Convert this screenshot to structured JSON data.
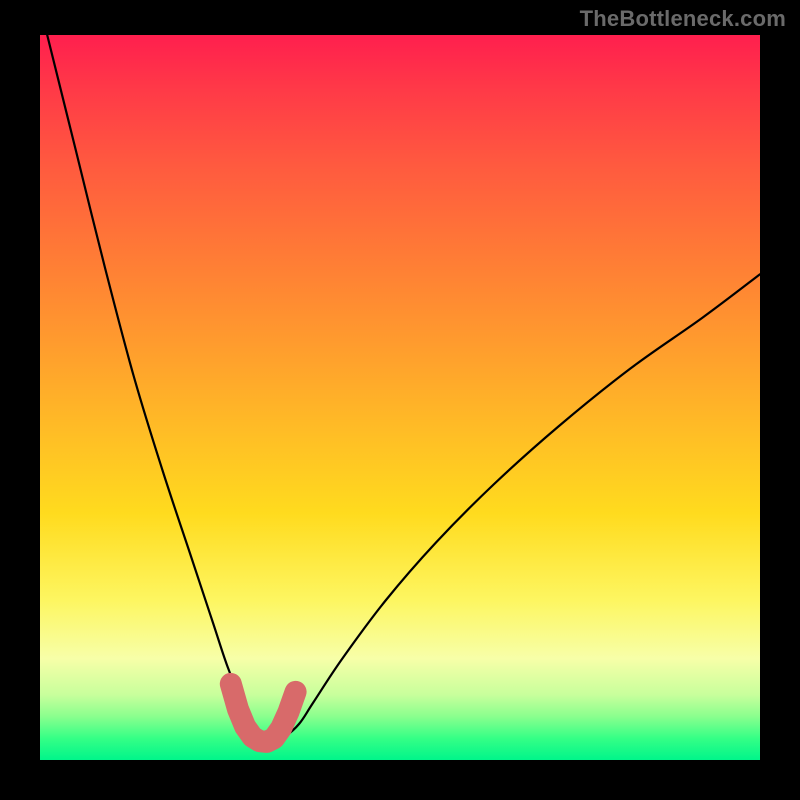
{
  "watermark": "TheBottleneck.com",
  "colors": {
    "frame": "#000000",
    "curve": "#000000",
    "marker": "#d86a6a"
  },
  "chart_data": {
    "type": "line",
    "title": "",
    "xlabel": "",
    "ylabel": "",
    "xlim": [
      0,
      100
    ],
    "ylim": [
      0,
      100
    ],
    "grid": false,
    "series": [
      {
        "name": "bottleneck-curve",
        "x": [
          1,
          5,
          9,
          13,
          17,
          21,
          24,
          26,
          28,
          29.5,
          31,
          32.5,
          34,
          36,
          38,
          42,
          48,
          55,
          63,
          72,
          82,
          92,
          100
        ],
        "y": [
          100,
          84,
          68,
          53,
          40,
          28,
          19,
          13,
          8,
          5,
          3.2,
          2.5,
          3.2,
          5,
          8,
          14,
          22,
          30,
          38,
          46,
          54,
          61,
          67
        ]
      }
    ],
    "markers": {
      "name": "highlight-band",
      "x": [
        26.5,
        27.5,
        28.5,
        29.5,
        30.5,
        31.5,
        32.5,
        33.5,
        34.5,
        35.5
      ],
      "y": [
        10.5,
        7.0,
        4.6,
        3.2,
        2.6,
        2.5,
        3.0,
        4.4,
        6.6,
        9.4
      ]
    }
  }
}
